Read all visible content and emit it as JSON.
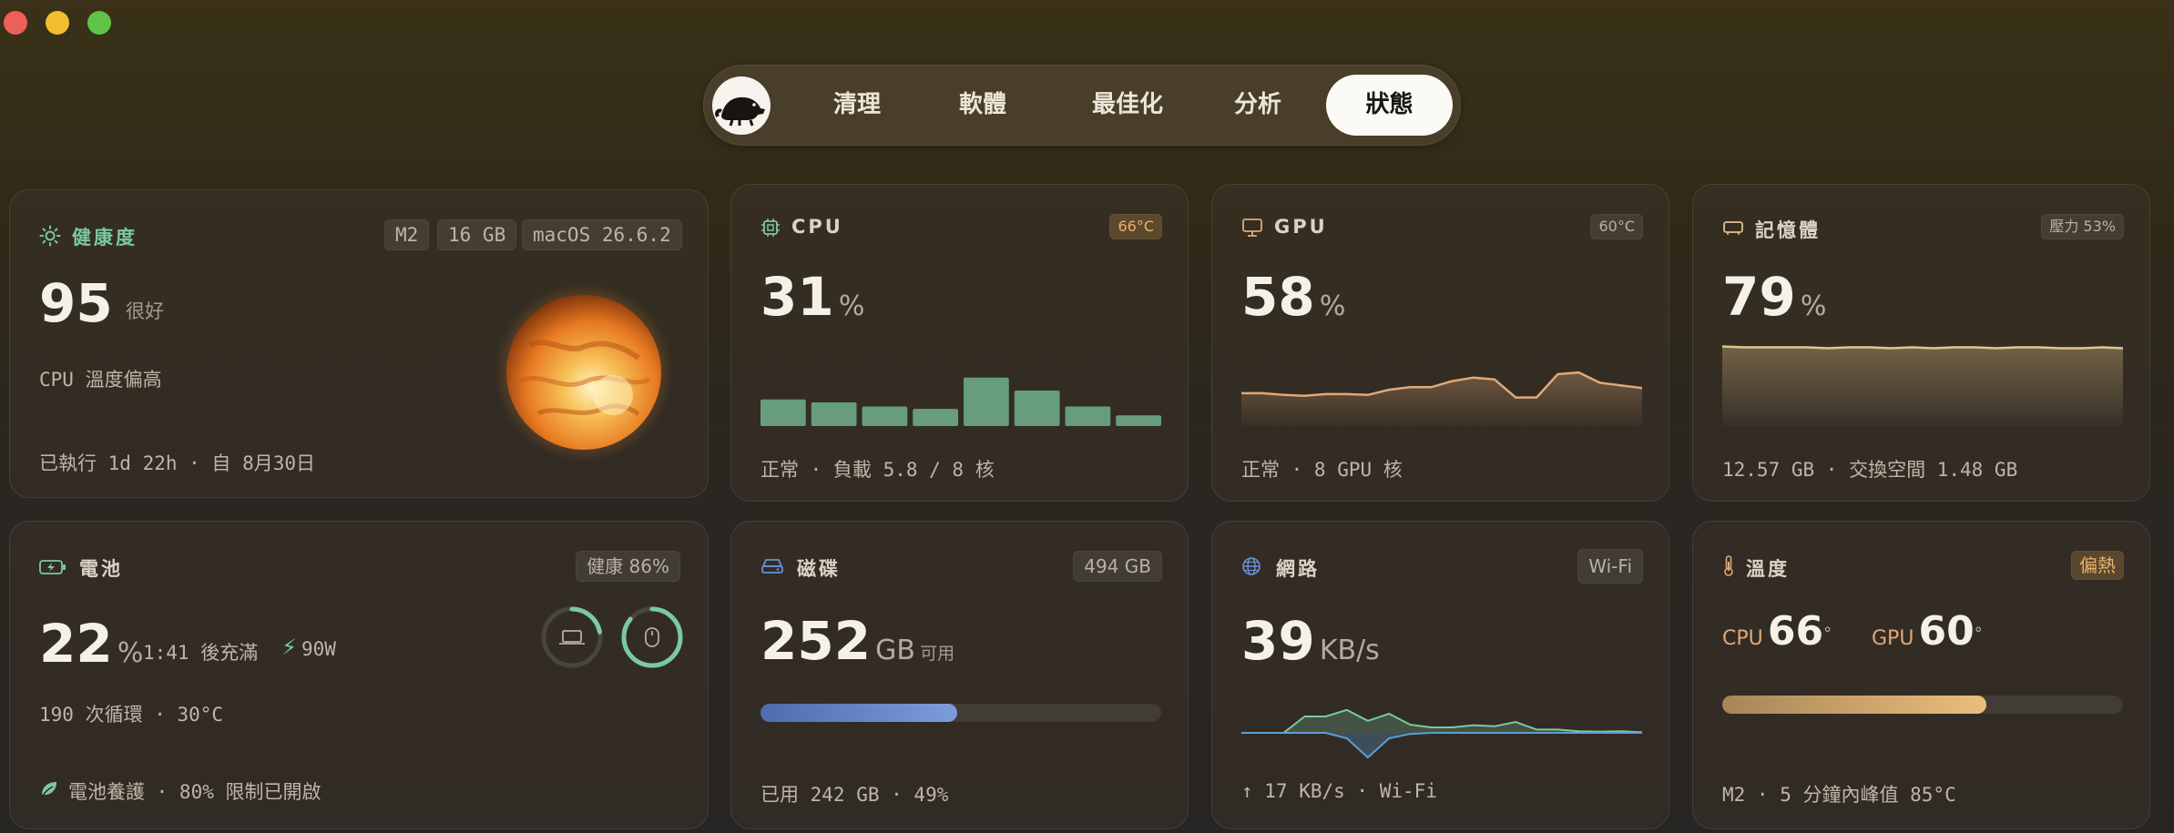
{
  "window_controls": {
    "close": "close",
    "minimize": "minimize",
    "zoom": "zoom"
  },
  "nav": {
    "tabs": [
      "清理",
      "軟體",
      "最佳化",
      "分析",
      "狀態"
    ],
    "active": "狀態"
  },
  "health": {
    "icon": "sun-icon",
    "title": "健康度",
    "chips": [
      "M2",
      "16 GB",
      "macOS 26.6.2"
    ],
    "score": "95",
    "rating": "很好",
    "note": "CPU 溫度偏高",
    "uptime": "已執行 1d 22h · 自 8月30日"
  },
  "cpu": {
    "icon": "chip-icon",
    "title": "CPU",
    "badge": "66°C",
    "value": "31",
    "unit": "%",
    "bars": [
      0.45,
      0.4,
      0.33,
      0.29,
      0.82,
      0.6,
      0.33,
      0.18
    ],
    "footer": "正常 · 負載 5.8 / 8 核",
    "color": "#7cc99e"
  },
  "gpu": {
    "icon": "display-icon",
    "title": "GPU",
    "badge": "60°C",
    "value": "58",
    "unit": "%",
    "history": [
      0.38,
      0.38,
      0.36,
      0.35,
      0.37,
      0.37,
      0.36,
      0.42,
      0.45,
      0.45,
      0.52,
      0.56,
      0.54,
      0.33,
      0.33,
      0.6,
      0.62,
      0.5,
      0.47,
      0.44
    ],
    "footer": "正常 · 8 GPU 核",
    "color": "#e0a878"
  },
  "memory": {
    "icon": "memory-icon",
    "title": "記憶體",
    "badge": "壓力 53%",
    "value": "79",
    "unit": "%",
    "history": [
      0.92,
      0.91,
      0.91,
      0.91,
      0.91,
      0.9,
      0.91,
      0.91,
      0.9,
      0.91,
      0.9,
      0.91,
      0.91,
      0.9,
      0.91,
      0.91,
      0.9,
      0.9,
      0.91,
      0.9
    ],
    "footer": "12.57 GB · 交換空間 1.48 GB",
    "color": "#e3c48c"
  },
  "battery": {
    "icon": "battery-icon",
    "title": "電池",
    "chip": "健康 86%",
    "value": "22",
    "unit": "%",
    "time": "1:41 後充滿",
    "power": "90W",
    "cycles": "190 次循環 · 30°C",
    "care": "電池養護 · 80% 限制已開啟",
    "rings": [
      {
        "icon": "laptop-icon",
        "level": 0.22
      },
      {
        "icon": "mouse-icon",
        "level": 0.86
      }
    ]
  },
  "disk": {
    "icon": "drive-icon",
    "title": "磁碟",
    "chip": "494 GB",
    "value": "252",
    "unit": "GB",
    "suffix": "可用",
    "used_fraction": 0.49,
    "footer": "已用 242 GB · 49%"
  },
  "network": {
    "icon": "globe-icon",
    "title": "網路",
    "chip": "Wi-Fi",
    "value": "39",
    "unit": "KB/s",
    "down_history": [
      0,
      0,
      0,
      0.3,
      0.3,
      0.42,
      0.22,
      0.35,
      0.15,
      0.1,
      0.1,
      0.14,
      0.12,
      0.2,
      0.06,
      0.06,
      0.03,
      0.02,
      0.03,
      0.01
    ],
    "up_history": [
      0,
      0,
      0,
      0,
      0,
      0.1,
      0.45,
      0.1,
      0.02,
      0,
      0,
      0,
      0,
      0,
      0,
      0,
      0,
      0,
      0,
      0
    ],
    "footer": "↑ 17 KB/s · Wi-Fi",
    "colors": {
      "down": "#7cc99e",
      "up": "#5a9fd8"
    }
  },
  "temperature": {
    "icon": "thermometer-icon",
    "title": "溫度",
    "chip": "偏熱",
    "cpu_label": "CPU",
    "cpu_value": "66",
    "gpu_label": "GPU",
    "gpu_value": "60",
    "degree": "°",
    "level": 0.66,
    "footer": "M2 · 5 分鐘內峰值 85°C"
  }
}
